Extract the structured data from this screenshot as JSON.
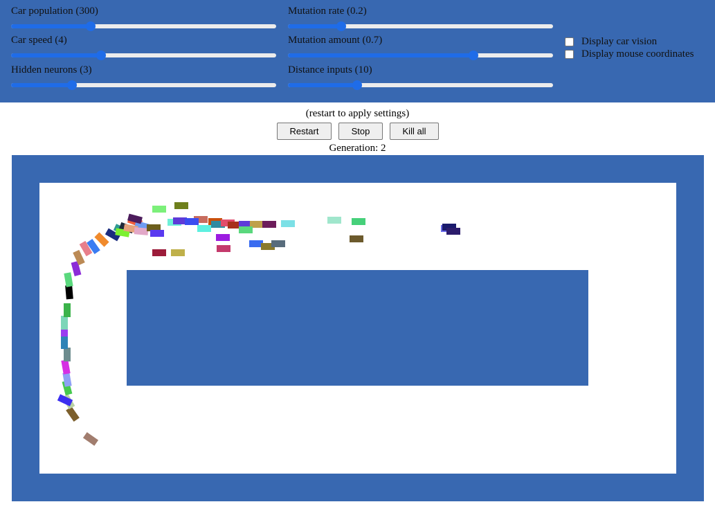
{
  "settings": {
    "car_population_label": "Car population (300)",
    "car_population_value": 0.3,
    "car_speed_label": "Car speed (4)",
    "car_speed_value": 0.34,
    "hidden_neurons_label": "Hidden neurons (3)",
    "hidden_neurons_value": 0.23,
    "mutation_rate_label": "Mutation rate (0.2)",
    "mutation_rate_value": 0.2,
    "mutation_amount_label": "Mutation amount (0.7)",
    "mutation_amount_value": 0.7,
    "distance_inputs_label": "Distance inputs (10)",
    "distance_inputs_value": 0.26,
    "display_car_vision_label": "Display car vision",
    "display_car_vision_checked": false,
    "display_mouse_coordinates_label": "Display mouse coordinates",
    "display_mouse_coordinates_checked": false
  },
  "hint": "(restart to apply settings)",
  "buttons": {
    "restart": "Restart",
    "stop": "Stop",
    "kill_all": "Kill all"
  },
  "generation": {
    "label": "Generation:",
    "value": "2"
  },
  "colors": {
    "track": "#3868b1",
    "panel": "#3868b1",
    "slider_accent": "#1f6ce8"
  },
  "cars": [
    {
      "c": "#a17d6e"
    },
    {
      "c": "#7c5f2c"
    },
    {
      "c": "#b8d1a4"
    },
    {
      "c": "#3c2ff0"
    },
    {
      "c": "#46c94e"
    },
    {
      "c": "#8ea0f5"
    },
    {
      "c": "#d62fe3"
    },
    {
      "c": "#6d8c8e"
    },
    {
      "c": "#2f83b6"
    },
    {
      "c": "#9a3cf0"
    },
    {
      "c": "#7cd6b8"
    },
    {
      "c": "#3bb34a"
    },
    {
      "c": "#000000"
    },
    {
      "c": "#5ad87d"
    },
    {
      "c": "#8c2bd8"
    },
    {
      "c": "#bb8a55"
    },
    {
      "c": "#e87f8b"
    },
    {
      "c": "#3a7cf2"
    },
    {
      "c": "#f08a2c"
    },
    {
      "c": "#1a2c7f"
    },
    {
      "c": "#2f9a92"
    },
    {
      "c": "#1f2a3a"
    },
    {
      "c": "#f05c3a"
    },
    {
      "c": "#6f9cf2"
    },
    {
      "c": "#4c1c5c"
    },
    {
      "c": "#7cf030"
    },
    {
      "c": "#e6a37c"
    },
    {
      "c": "#e2a8c8"
    },
    {
      "c": "#6c5e1c"
    },
    {
      "c": "#7cf07a"
    },
    {
      "c": "#6e7f1c"
    },
    {
      "c": "#5a3af0"
    },
    {
      "c": "#9c1c3a"
    },
    {
      "c": "#bfb04a"
    },
    {
      "c": "#6ef0d8"
    },
    {
      "c": "#5e3ad8"
    },
    {
      "c": "#c86c5e"
    },
    {
      "c": "#3a4cf0"
    },
    {
      "c": "#c8500c"
    },
    {
      "c": "#5ef0e0"
    },
    {
      "c": "#2f8aa0"
    },
    {
      "c": "#e24c6c"
    },
    {
      "c": "#a8301c"
    },
    {
      "c": "#5e3ad8"
    },
    {
      "c": "#bfa04a"
    },
    {
      "c": "#5ad87d"
    },
    {
      "c": "#6c1c5a"
    },
    {
      "c": "#7ce0e6"
    },
    {
      "c": "#a0e6cc"
    },
    {
      "c": "#46d07a"
    },
    {
      "c": "#6c5a2c"
    },
    {
      "c": "#9c1ce0"
    },
    {
      "c": "#c43a6c"
    },
    {
      "c": "#3a6cf0"
    },
    {
      "c": "#8a7a2c"
    },
    {
      "c": "#586c7c"
    },
    {
      "c": "#6a6ae8"
    },
    {
      "c": "#1a1a6c"
    },
    {
      "c": "#2c1c6c"
    },
    {
      "c": "#e68c8c"
    },
    {
      "c": "#e6c80c"
    }
  ]
}
